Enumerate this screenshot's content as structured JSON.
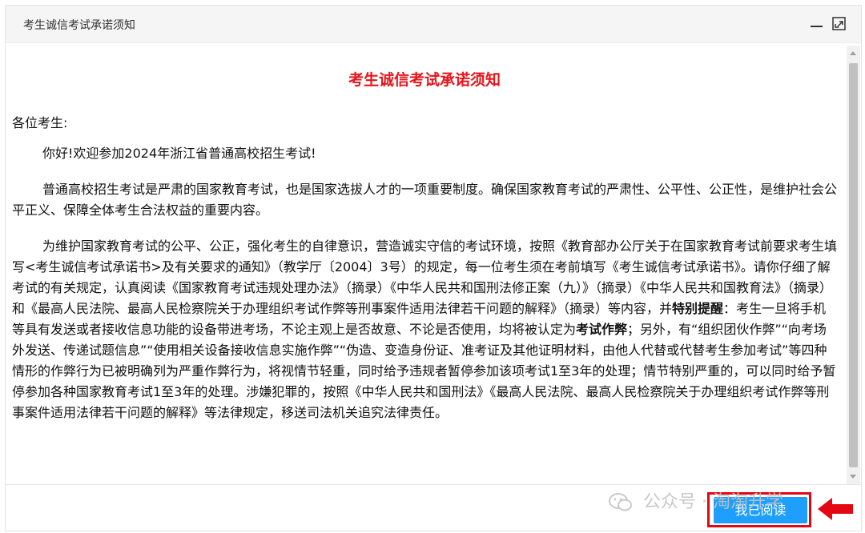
{
  "window": {
    "title": "考生诚信考试承诺须知"
  },
  "document": {
    "heading": "考生诚信考试承诺须知",
    "greeting": "各位考生:",
    "p1": "你好!欢迎参加2024年浙江省普通高校招生考试!",
    "p2": "普通高校招生考试是严肃的国家教育考试，也是国家选拔人才的一项重要制度。确保国家教育考试的严肃性、公平性、公正性，是维护社会公平正义、保障全体考生合法权益的重要内容。",
    "p3": {
      "part1": "为维护国家教育考试的公平、公正，强化考生的自律意识，营造诚实守信的考试环境，按照《教育部办公厅关于在国家教育考试前要求考生填写<考生诚信考试承诺书>及有关要求的通知》（教学厅〔2004〕3号）的规定，每一位考生须在考前填写《考生诚信考试承诺书》。请你仔细了解考试的有关规定，认真阅读《国家教育考试违规处理办法》（摘录）《中华人民共和国刑法修正案（九）》（摘录）《中华人民共和国教育法》（摘录）和《最高人民法院、最高人民检察院关于办理组织考试作弊等刑事案件适用法律若干问题的解释》（摘录）等内容，并",
      "bold1": "特别提醒",
      "part2": "：考生一旦将手机等具有发送或者接收信息功能的设备带进考场，不论主观上是否故意、不论是否使用，均将被认定为",
      "bold2": "考试作弊",
      "part3": "；另外，有“组织团伙作弊”“向考场外发送、传递试题信息”“使用相关设备接收信息实施作弊”“伪造、变造身份证、准考证及其他证明材料，由他人代替或代替考生参加考试”等四种情形的作弊行为已被明确列为严重作弊行为，将视情节轻重，同时给予违规者暂停参加该项考试1至3年的处理；情节特别严重的，可以同时给予暂停参加各种国家教育考试1至3年的处理。涉嫌犯罪的，按照《中华人民共和国刑法》《最高人民法院、最高人民检察院关于办理组织考试作弊等刑事案件适用法律若干问题的解释》等法律规定，移送司法机关追究法律责任。"
    }
  },
  "footer": {
    "read_button": "我已阅读"
  },
  "watermark": {
    "text": "公众号 · 淘淘升学"
  },
  "colors": {
    "heading": "#e6151b",
    "button": "#1e9fff",
    "highlight": "#e30613"
  },
  "icons": {
    "minimize": "minimize-icon",
    "maximize": "maximize-icon",
    "arrow": "red-arrow-icon",
    "wechat": "wechat-icon"
  }
}
